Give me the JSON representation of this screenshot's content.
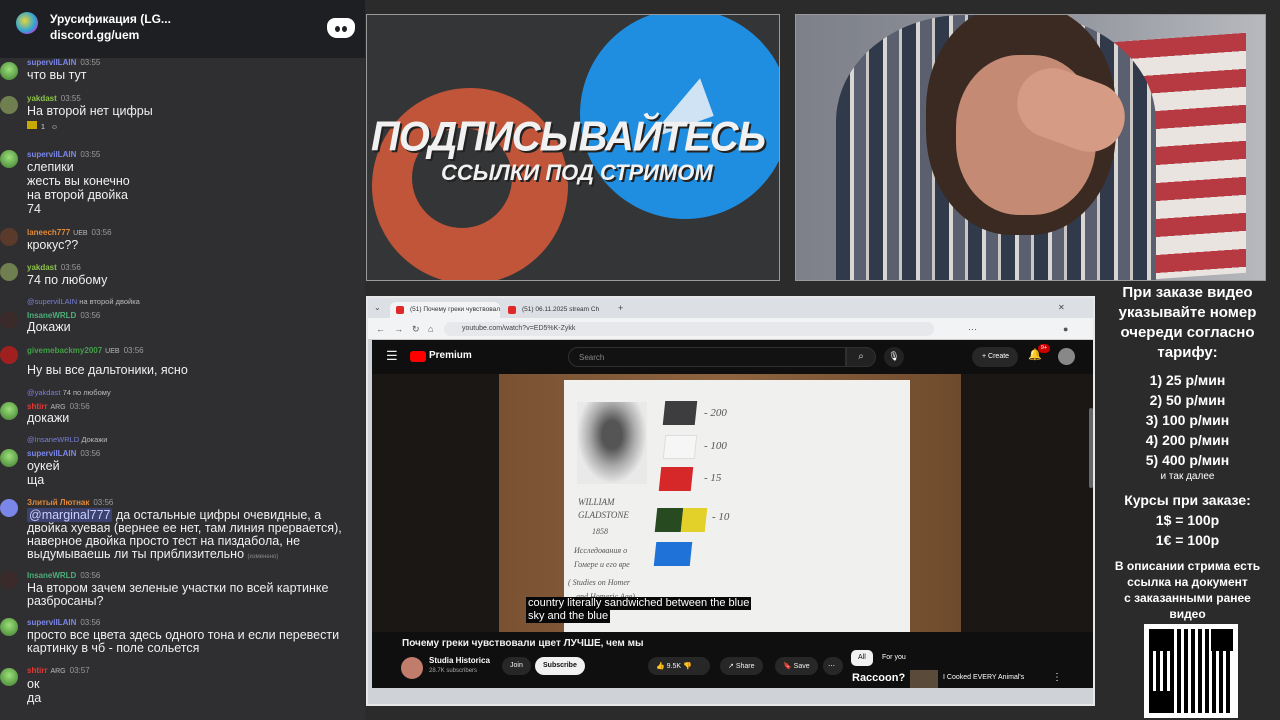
{
  "chat": {
    "server_title": "Урусификация (LG...",
    "invite": "discord.gg/uem",
    "messages": [
      {
        "name": "supervilLAIN",
        "time": "03:55",
        "badge": "",
        "color": "#7b87e8",
        "lines": [
          "что вы тут"
        ]
      },
      {
        "name": "yakdast",
        "time": "03:55",
        "badge": "",
        "color": "#8bc34a",
        "lines": [
          "На второй нет цифры"
        ],
        "reaction": "1"
      },
      {
        "name": "supervilLAIN",
        "time": "03:55",
        "badge": "",
        "color": "#7b87e8",
        "lines": [
          "слепики",
          "жесть вы конечно",
          "на второй двойка",
          "74"
        ]
      },
      {
        "name": "laneech777",
        "time": "03:56",
        "badge": "UEB",
        "color": "#e0893a",
        "lines": [
          "крокус??"
        ]
      },
      {
        "name": "yakdast",
        "time": "03:56",
        "badge": "",
        "color": "#8bc34a",
        "lines": [
          "74 по любому"
        ]
      },
      {
        "name": "InsaneWRLD",
        "time": "03:56",
        "badge": "",
        "color": "#4caf7a",
        "reply_name": "@supervilLAIN",
        "reply_text": "на второй двойка",
        "lines": [
          "Докажи"
        ]
      },
      {
        "name": "givemebackmy2007",
        "time": "03:56",
        "badge": "UEB",
        "color": "#43a047",
        "lines": [
          "Ну вы все дальтоники, ясно"
        ]
      },
      {
        "name": "shtirr",
        "time": "03:56",
        "badge": "ARG",
        "color": "#e53935",
        "reply_name": "@yakdast",
        "reply_text": "74 по любому",
        "lines": [
          "докажи"
        ]
      },
      {
        "name": "supervilLAIN",
        "time": "03:56",
        "badge": "",
        "color": "#7b87e8",
        "reply_name": "@InsaneWRLD",
        "reply_text": "Докажи",
        "lines": [
          "оукей",
          "ща"
        ]
      },
      {
        "name": "Злитый Лютнак",
        "time": "03:56",
        "badge": "",
        "color": "#e0893a",
        "mention": "@marginal777",
        "lines": [
          " да остальные цифры очевидные, а",
          "двойка хуевая (вернее ее нет, там линия прервается),",
          "наверное двойка просто тест на пиздабола, не",
          "выдумываешь ли ты приблизительно"
        ],
        "edited": "(изменено)"
      },
      {
        "name": "InsaneWRLD",
        "time": "03:56",
        "badge": "",
        "color": "#4caf7a",
        "lines": [
          "На втором зачем зеленые участки по всей картинке",
          "разбросаны?"
        ]
      },
      {
        "name": "supervilLAIN",
        "time": "03:56",
        "badge": "",
        "color": "#7b87e8",
        "lines": [
          "просто все цвета здесь одного тона и если перевести",
          "картинку в чб - поле сольется"
        ]
      },
      {
        "name": "shtirr",
        "time": "03:57",
        "badge": "ARG",
        "color": "#e53935",
        "lines": [
          "ок",
          "да"
        ]
      }
    ]
  },
  "promo": {
    "line1": "ПОДПИСЫВАЙТЕСЬ",
    "line2": "ССЫЛКИ ПОД СТРИМОМ"
  },
  "browser": {
    "tab1": "(51) Почему греки чувствовал",
    "tab2": "(51) 06.11.2025 stream Ch",
    "url": "youtube.com/watch?v=ED5%K-Zykk"
  },
  "youtube": {
    "brand": "Premium",
    "search_placeholder": "Search",
    "create": "Create",
    "notif_count": "9+",
    "caption_line1": "country literally sandwiched between the blue",
    "caption_line2": "sky and the blue",
    "video_title": "Почему греки чувствовали цвет ЛУЧШЕ, чем мы",
    "channel": "Studia Historica",
    "subscribers": "28.7K subscribers",
    "join": "Join",
    "subscribe": "Subscribe",
    "likes": "9.5K",
    "share": "Share",
    "save": "Save",
    "chip_all": "All",
    "chip_foryou": "For you",
    "rec1": "Raccoon?",
    "rec2": "I Cooked EVERY Animal's",
    "paper": {
      "n200": "200",
      "n100": "100",
      "n15": "15",
      "n10": "10",
      "name1": "WILLIAM",
      "name2": "GLADSTONE",
      "year": "1858",
      "ru1": "Исследования о",
      "ru2": "Гомере и его вре",
      "en1": "( Studies on Homer",
      "en2": "and Homeric Age)"
    }
  },
  "info": {
    "l1": "При заказе видео",
    "l2": "указывайте номер",
    "l3": "очереди согласно",
    "l4": "тарифу:",
    "t1": "1) 25 р/мин",
    "t2": "2) 50 р/мин",
    "t3": "3) 100 р/мин",
    "t4": "4) 200 р/мин",
    "t5": "5) 400 р/мин",
    "more": "и так далее",
    "c1": "Курсы при заказе:",
    "c2": "1$ = 100р",
    "c3": "1€ = 100р",
    "d1": "В описании стрима есть",
    "d2": "ссылка на документ",
    "d3": "с заказанными ранее",
    "d4": "видео"
  }
}
